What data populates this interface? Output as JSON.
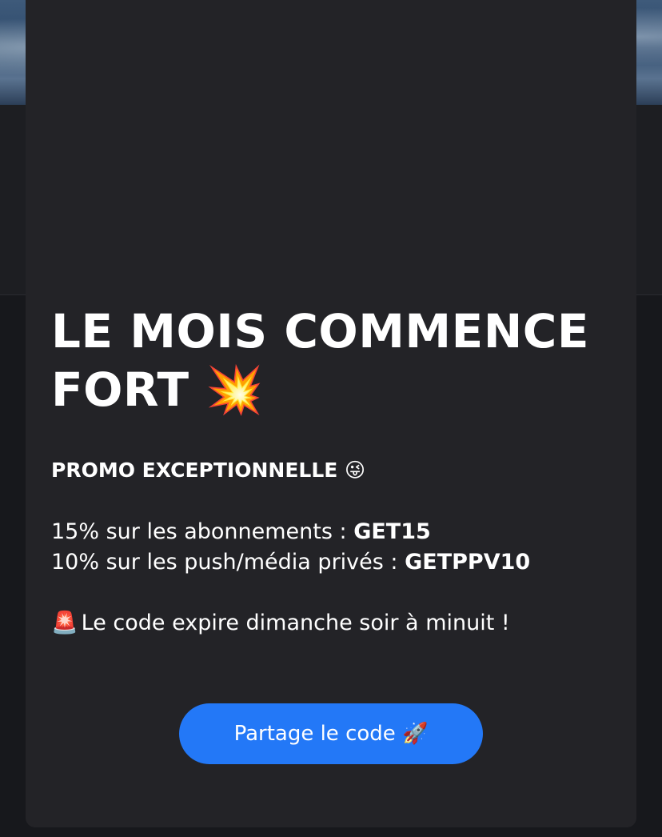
{
  "modal": {
    "title": "LE MOIS COMMENCE FORT 💥",
    "promo_heading": "PROMO EXCEPTIONNELLE 😜",
    "offers": [
      {
        "text": "15% sur les abonnements : ",
        "code": "GET15"
      },
      {
        "text": "10% sur les push/média privés : ",
        "code": "GETPPV10"
      }
    ],
    "expiry_icon": "🚨",
    "expiry_text": "Le code expire dimanche soir à minuit !",
    "share_button_label": "Partage le code 🚀"
  },
  "colors": {
    "modal_background": "#232327",
    "button_accent": "#2378f7",
    "text": "#ffffff"
  }
}
